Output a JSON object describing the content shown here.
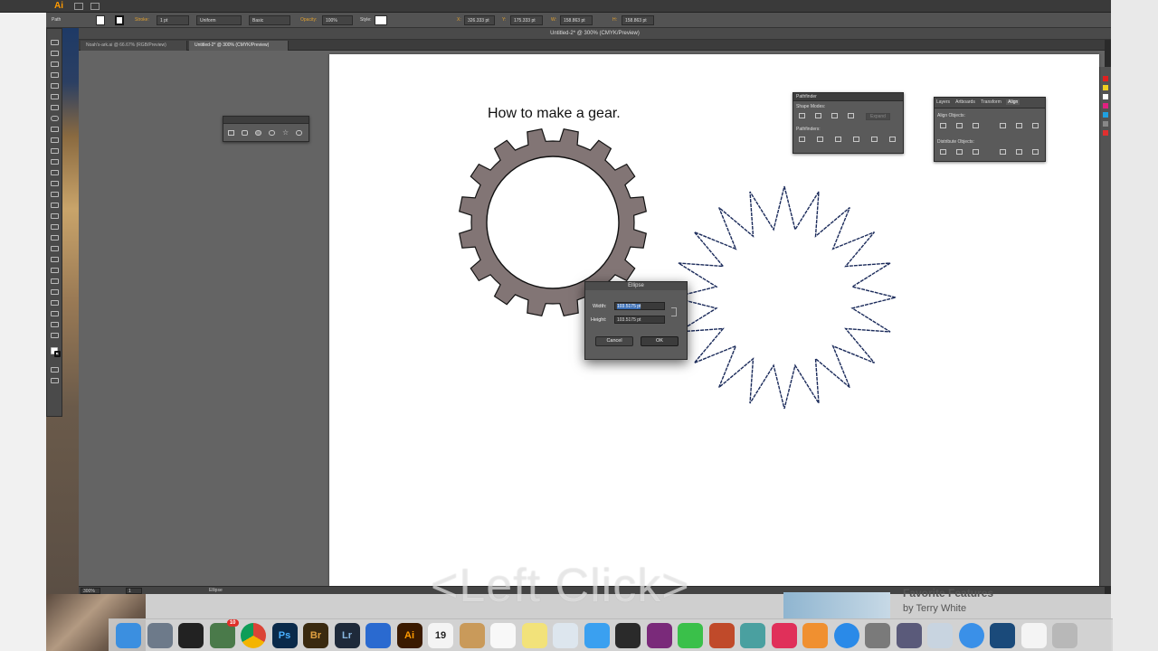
{
  "app": {
    "logo": "Ai",
    "window_title": "Untitled-2* @ 300% (CMYK/Preview)"
  },
  "control_bar": {
    "selection": "Path",
    "stroke_label": "Stroke:",
    "stroke_weight": "1 pt",
    "profile": "Uniform",
    "brush": "Basic",
    "opacity_label": "Opacity:",
    "opacity": "100%",
    "style_label": "Style:",
    "x_label": "X:",
    "x_value": "326.333 pt",
    "y_label": "Y:",
    "y_value": "175.333 pt",
    "w_label": "W:",
    "w_value": "158.863 pt",
    "h_label": "H:",
    "h_value": "158.863 pt"
  },
  "doc_tabs": [
    {
      "label": "Noah's-ark.ai @ 66.67% (RGB/Preview)"
    },
    {
      "label": "Untitled-2* @ 300% (CMYK/Preview)"
    }
  ],
  "artboard": {
    "heading": "How to make a gear."
  },
  "pathfinder_panel": {
    "title": "Pathfinder",
    "shape_modes": "Shape Modes:",
    "expand": "Expand",
    "pathfinders": "Pathfinders:"
  },
  "align_panel": {
    "tabs": [
      "Layers",
      "Artboards",
      "Transform",
      "Align"
    ],
    "align_objects": "Align Objects:",
    "distribute_objects": "Distribute Objects:"
  },
  "ellipse_dialog": {
    "title": "Ellipse",
    "width_label": "Width:",
    "width_value": "103.5175 pt",
    "height_label": "Height:",
    "height_value": "103.5175 pt",
    "cancel": "Cancel",
    "ok": "OK"
  },
  "status_bar": {
    "zoom": "300%",
    "artboard_no": "1",
    "tool": "Ellipse"
  },
  "overlay": {
    "caption": "<Left Click>"
  },
  "background_web": {
    "headline": "Favorite Features",
    "byline": "by Terry White"
  },
  "dock": {
    "calendar_day": "19",
    "mail_badge": "10",
    "apps": [
      "finder-icon",
      "launchpad-icon",
      "mission-control-icon",
      "iphoto-icon",
      "chrome-icon",
      "photoshop-icon",
      "bridge-icon",
      "lightroom-icon",
      "keynote-icon",
      "illustrator-icon",
      "calendar-icon",
      "notes-icon",
      "reminders-icon",
      "stickies-icon",
      "preview-icon",
      "messages-icon",
      "hp-icon",
      "photo-booth-icon",
      "facetime-icon",
      "photos-icon",
      "maps-icon",
      "itunes-icon",
      "ibooks-icon",
      "app-store-icon",
      "system-preferences-icon",
      "pencil-icon",
      "mail-icon",
      "safari-icon",
      "quicktime-icon",
      "document-icon",
      "downloads-icon"
    ]
  },
  "colors": {
    "gear_fill": "#827575",
    "artboard_bg": "#ffffff",
    "canvas_bg": "#646464",
    "accent_orange": "#ff9a00"
  }
}
